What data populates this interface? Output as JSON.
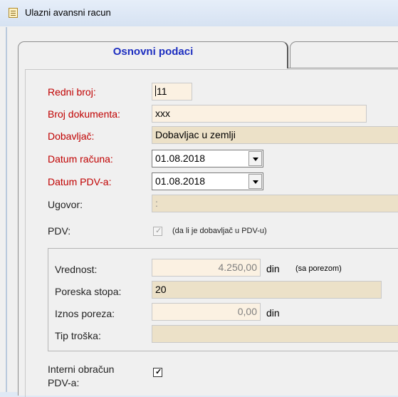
{
  "window": {
    "title": "Ulazni avansni racun"
  },
  "tabs": {
    "active_label": "Osnovni podaci",
    "second_label": ""
  },
  "form": {
    "redni_broj": {
      "label": "Redni broj:",
      "value": "11"
    },
    "broj_dokumenta": {
      "label": "Broj dokumenta:",
      "value": "xxx"
    },
    "dobavljac": {
      "label": "Dobavljač:",
      "value": "Dobavljac u zemlji"
    },
    "datum_racuna": {
      "label": "Datum računa:",
      "value": "01.08.2018"
    },
    "datum_pdv": {
      "label": "Datum PDV-a:",
      "value": "01.08.2018"
    },
    "ugovor": {
      "label": "Ugovor:",
      "value": ":"
    },
    "pdv": {
      "label": "PDV:",
      "checked": true,
      "note": "(da li je dobavljač u PDV-u)"
    },
    "vrednost": {
      "label": "Vrednost:",
      "value": "4.250,00",
      "unit": "din",
      "note": "(sa porezom)"
    },
    "poreska_stopa": {
      "label": "Poreska stopa:",
      "value": "20"
    },
    "iznos_poreza": {
      "label": "Iznos poreza:",
      "value": "0,00",
      "unit": "din"
    },
    "tip_troska": {
      "label": "Tip troška:",
      "value": ""
    },
    "interni_obracun": {
      "label_line1": "Interni obračun",
      "label_line2": "PDV-a:",
      "checked": true
    }
  },
  "colors": {
    "required_label": "#c00000",
    "tab_label": "#1d2ec0",
    "field_cream": "#fbf1e2",
    "field_tan": "#ece1c8"
  }
}
